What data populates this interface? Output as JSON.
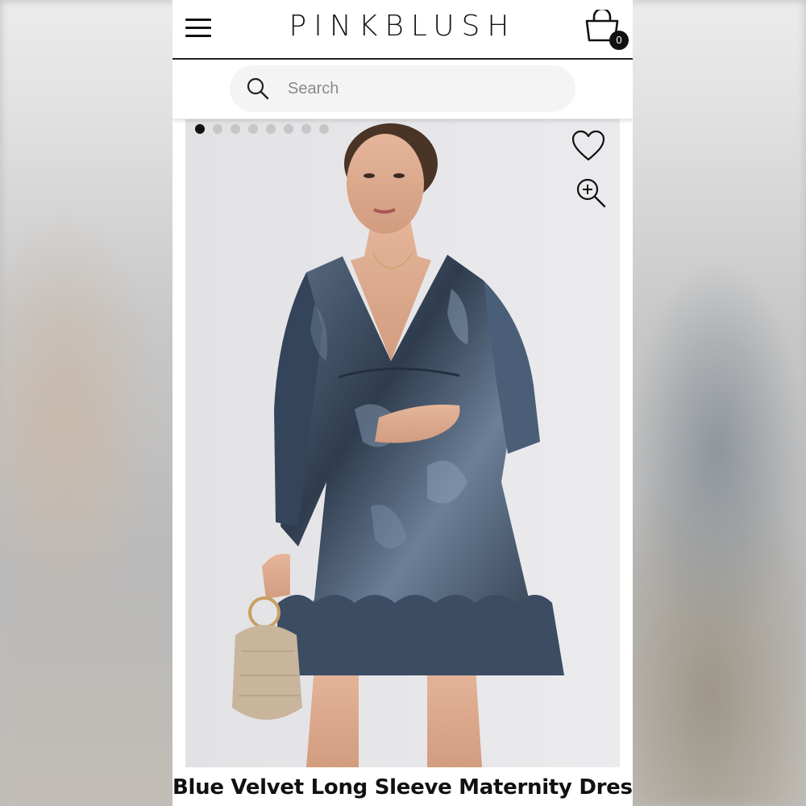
{
  "header": {
    "brand": "PINKBLUSH",
    "menu_icon": "hamburger-menu-icon",
    "cart_icon": "shopping-bag-icon",
    "cart_count": "0"
  },
  "search": {
    "placeholder": "Search",
    "value": "",
    "icon": "search-icon"
  },
  "gallery": {
    "image_count": 8,
    "active_index": 0,
    "favorite_icon": "heart-icon",
    "zoom_icon": "zoom-in-icon"
  },
  "product": {
    "title": "Blue Velvet Long Sleeve Maternity Dress"
  },
  "colors": {
    "accent": "#111111",
    "page_bg": "#ffffff",
    "image_bg": "#e6e6e9",
    "dress": "#3a4a5e"
  }
}
